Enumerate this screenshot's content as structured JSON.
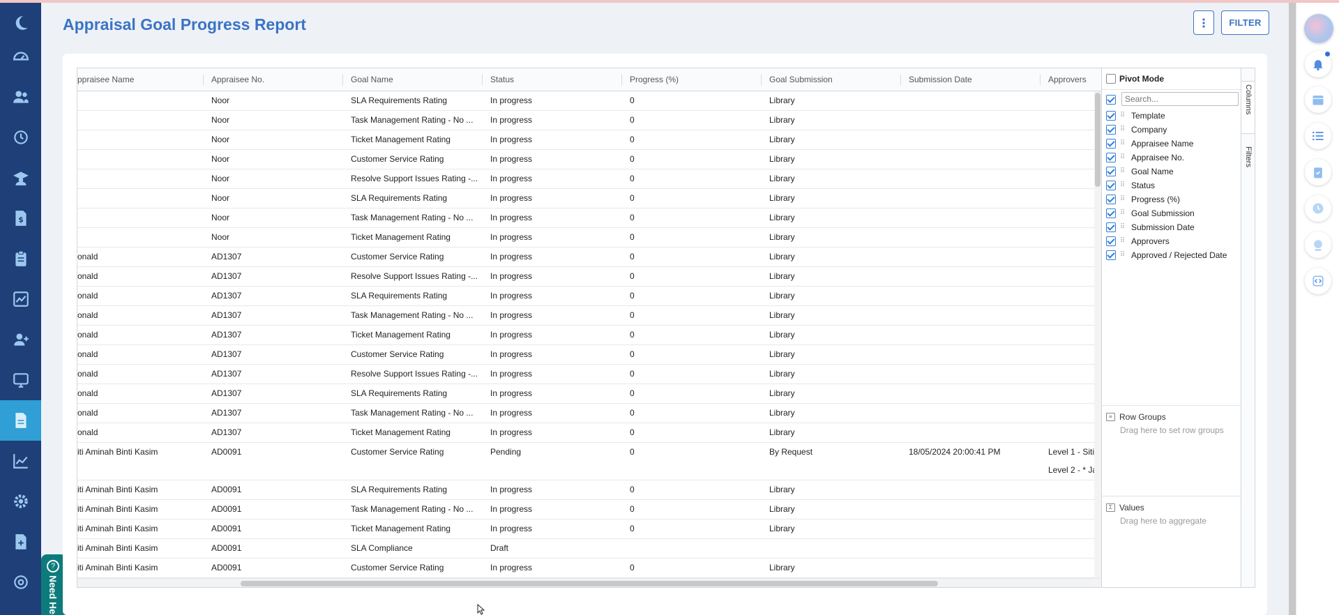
{
  "page": {
    "title": "Appraisal Goal Progress Report",
    "filter_label": "FILTER",
    "need_help": "Need He"
  },
  "sidebar": {
    "items": [
      {
        "icon": "moon-logo-icon"
      },
      {
        "icon": "dashboard-gauge-icon"
      },
      {
        "icon": "people-icon"
      },
      {
        "icon": "history-icon"
      },
      {
        "icon": "graduate-icon"
      },
      {
        "icon": "payroll-dollar-icon"
      },
      {
        "icon": "clipboard-icon"
      },
      {
        "icon": "chart-icon"
      },
      {
        "icon": "add-user-icon"
      },
      {
        "icon": "monitor-icon"
      },
      {
        "icon": "report-document-icon",
        "active": true
      },
      {
        "icon": "line-chart-icon"
      },
      {
        "icon": "settings-gear-icon"
      },
      {
        "icon": "file-add-icon"
      },
      {
        "icon": "at-icon"
      }
    ]
  },
  "columns": [
    "ppraisee Name",
    "Appraisee No.",
    "Goal Name",
    "Status",
    "Progress (%)",
    "Goal Submission",
    "Submission Date",
    "Approvers"
  ],
  "rows": [
    [
      "",
      "Noor",
      "SLA Requirements Rating",
      "In progress",
      "0",
      "Library",
      "",
      ""
    ],
    [
      "",
      "Noor",
      "Task Management Rating - No ...",
      "In progress",
      "0",
      "Library",
      "",
      ""
    ],
    [
      "",
      "Noor",
      "Ticket Management Rating",
      "In progress",
      "0",
      "Library",
      "",
      ""
    ],
    [
      "",
      "Noor",
      "Customer Service Rating",
      "In progress",
      "0",
      "Library",
      "",
      ""
    ],
    [
      "",
      "Noor",
      "Resolve Support Issues Rating -...",
      "In progress",
      "0",
      "Library",
      "",
      ""
    ],
    [
      "",
      "Noor",
      "SLA Requirements Rating",
      "In progress",
      "0",
      "Library",
      "",
      ""
    ],
    [
      "",
      "Noor",
      "Task Management Rating - No ...",
      "In progress",
      "0",
      "Library",
      "",
      ""
    ],
    [
      "",
      "Noor",
      "Ticket Management Rating",
      "In progress",
      "0",
      "Library",
      "",
      ""
    ],
    [
      "onald",
      "AD1307",
      "Customer Service Rating",
      "In progress",
      "0",
      "Library",
      "",
      ""
    ],
    [
      "onald",
      "AD1307",
      "Resolve Support Issues Rating -...",
      "In progress",
      "0",
      "Library",
      "",
      ""
    ],
    [
      "onald",
      "AD1307",
      "SLA Requirements Rating",
      "In progress",
      "0",
      "Library",
      "",
      ""
    ],
    [
      "onald",
      "AD1307",
      "Task Management Rating - No ...",
      "In progress",
      "0",
      "Library",
      "",
      ""
    ],
    [
      "onald",
      "AD1307",
      "Ticket Management Rating",
      "In progress",
      "0",
      "Library",
      "",
      ""
    ],
    [
      "onald",
      "AD1307",
      "Customer Service Rating",
      "In progress",
      "0",
      "Library",
      "",
      ""
    ],
    [
      "onald",
      "AD1307",
      "Resolve Support Issues Rating -...",
      "In progress",
      "0",
      "Library",
      "",
      ""
    ],
    [
      "onald",
      "AD1307",
      "SLA Requirements Rating",
      "In progress",
      "0",
      "Library",
      "",
      ""
    ],
    [
      "onald",
      "AD1307",
      "Task Management Rating - No ...",
      "In progress",
      "0",
      "Library",
      "",
      ""
    ],
    [
      "onald",
      "AD1307",
      "Ticket Management Rating",
      "In progress",
      "0",
      "Library",
      "",
      ""
    ],
    [
      "iti Aminah Binti Kasim",
      "AD0091",
      "Customer Service Rating",
      "Pending",
      "0",
      "By Request",
      "18/05/2024 20:00:41 PM",
      "Level 1 - Siti",
      "Level 2 - * Ja"
    ],
    [
      "iti Aminah Binti Kasim",
      "AD0091",
      "SLA Requirements Rating",
      "In progress",
      "0",
      "Library",
      "",
      ""
    ],
    [
      "iti Aminah Binti Kasim",
      "AD0091",
      "Task Management Rating - No ...",
      "In progress",
      "0",
      "Library",
      "",
      ""
    ],
    [
      "iti Aminah Binti Kasim",
      "AD0091",
      "Ticket Management Rating",
      "In progress",
      "0",
      "Library",
      "",
      ""
    ],
    [
      "iti Aminah Binti Kasim",
      "AD0091",
      "SLA Compliance",
      "Draft",
      "",
      "",
      "",
      ""
    ],
    [
      "iti Aminah Binti Kasim",
      "AD0091",
      "Customer Service Rating",
      "In progress",
      "0",
      "Library",
      "",
      ""
    ]
  ],
  "tool_panel": {
    "pivot_mode": "Pivot Mode",
    "search_placeholder": "Search...",
    "columns": [
      "Template",
      "Company",
      "Appraisee Name",
      "Appraisee No.",
      "Goal Name",
      "Status",
      "Progress (%)",
      "Goal Submission",
      "Submission Date",
      "Approvers",
      "Approved / Rejected Date"
    ],
    "row_groups_title": "Row Groups",
    "row_groups_hint": "Drag here to set row groups",
    "values_title": "Values",
    "values_hint": "Drag here to aggregate",
    "tab_columns": "Columns",
    "tab_filters": "Filters"
  },
  "right_rail": {
    "items": [
      "avatar",
      "notification-bell-icon",
      "calendar-icon",
      "list-icon",
      "clipboard-check-icon",
      "clock-icon",
      "globe-icon",
      "code-icon"
    ]
  },
  "colors": {
    "sidebar_bg": "#1f3f78",
    "sidebar_active": "#2f9fd6",
    "accent": "#3b73c5",
    "need_help_bg": "#0d7b7b"
  }
}
